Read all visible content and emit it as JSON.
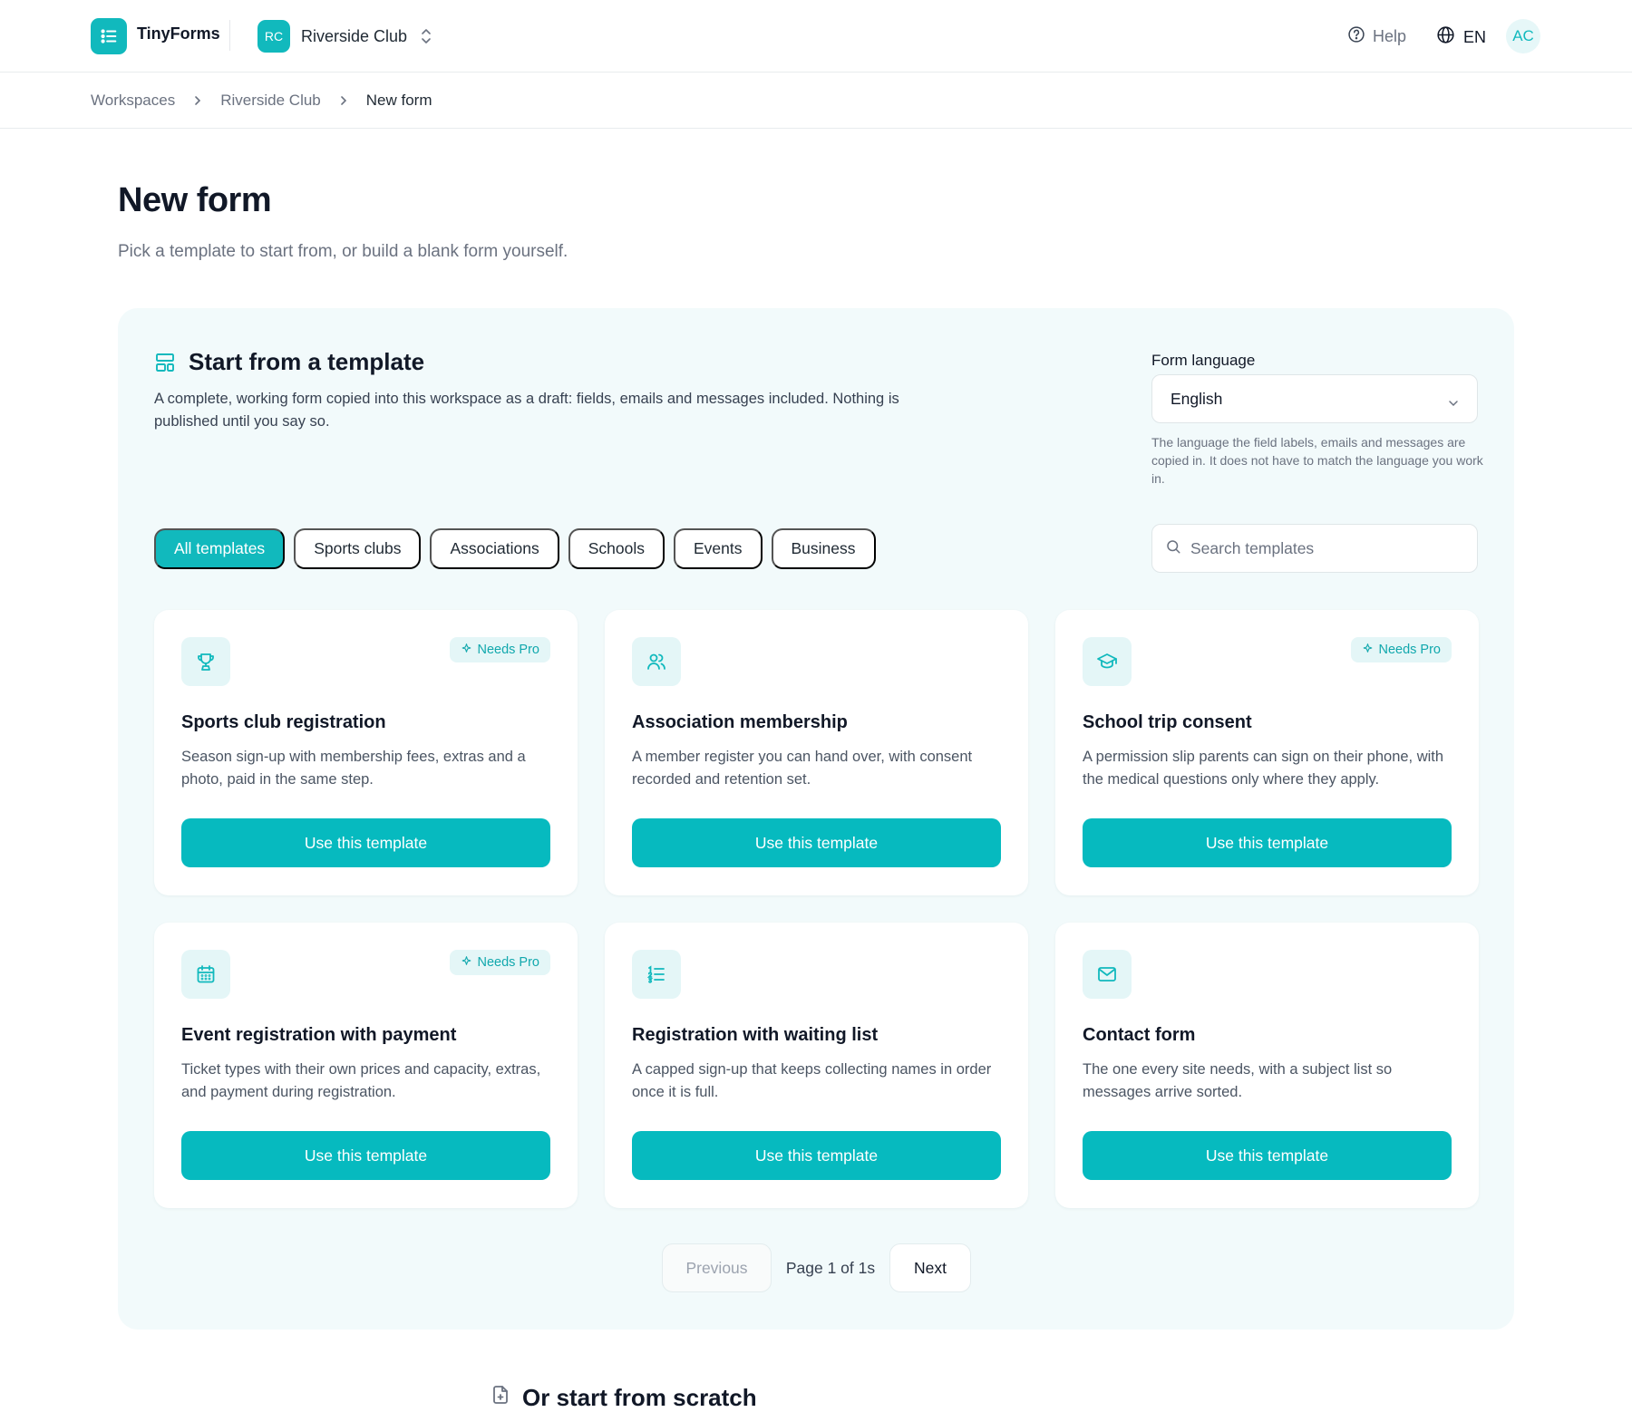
{
  "app": {
    "name": "TinyForms"
  },
  "workspace": {
    "initials": "RC",
    "name": "Riverside Club"
  },
  "header": {
    "help": "Help",
    "language": "EN",
    "avatar": "AC"
  },
  "breadcrumb": [
    "Workspaces",
    "Riverside Club",
    "New form"
  ],
  "page": {
    "title": "New form",
    "subtitle": "Pick a template to start from, or build a blank form yourself."
  },
  "templates_section": {
    "title": "Start from a template",
    "description": "A complete, working form copied into this workspace as a draft: fields, emails and messages included. Nothing is published until you say so.",
    "form_language": {
      "label": "Form language",
      "value": "English",
      "help": "The language the field labels, emails and messages are copied in. It does not have to match the language you work in."
    },
    "filters": [
      "All templates",
      "Sports clubs",
      "Associations",
      "Schools",
      "Events",
      "Business"
    ],
    "active_filter": "All templates",
    "search_placeholder": "Search templates",
    "pro_badge": "Needs Pro",
    "button_label": "Use this template",
    "cards": [
      {
        "icon": "trophy-icon",
        "title": "Sports club registration",
        "description": "Season sign-up with membership fees, extras and a photo, paid in the same step.",
        "needs_pro": true
      },
      {
        "icon": "users-icon",
        "title": "Association membership",
        "description": "A member register you can hand over, with consent recorded and retention set.",
        "needs_pro": false
      },
      {
        "icon": "graduation-cap-icon",
        "title": "School trip consent",
        "description": "A permission slip parents can sign on their phone, with the medical questions only where they apply.",
        "needs_pro": true
      },
      {
        "icon": "calendar-icon",
        "title": "Event registration with payment",
        "description": "Ticket types with their own prices and capacity, extras, and payment during registration.",
        "needs_pro": true
      },
      {
        "icon": "numbered-list-icon",
        "title": "Registration with waiting list",
        "description": "A capped sign-up that keeps collecting names in order once it is full.",
        "needs_pro": false
      },
      {
        "icon": "mail-icon",
        "title": "Contact form",
        "description": "The one every site needs, with a subject list so messages arrive sorted.",
        "needs_pro": false
      }
    ],
    "pagination": {
      "previous": "Previous",
      "info": "Page 1 of 1s",
      "next": "Next"
    }
  },
  "scratch_section": {
    "title": "Or start from scratch"
  },
  "colors": {
    "accent": "#06babf",
    "panel_bg": "#f2fafb",
    "icon_bg": "#e4f6f7"
  }
}
